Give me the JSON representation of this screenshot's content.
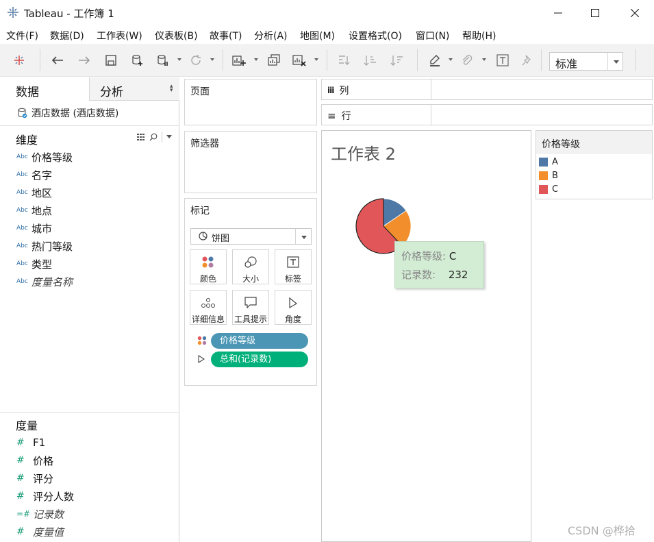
{
  "window": {
    "title": "Tableau - 工作簿 1"
  },
  "menu": [
    "文件(F)",
    "数据(D)",
    "工作表(W)",
    "仪表板(B)",
    "故事(T)",
    "分析(A)",
    "地图(M)",
    "设置格式(O)",
    "窗口(N)",
    "帮助(H)"
  ],
  "toolbar": {
    "view_mode": "标准"
  },
  "data_pane": {
    "tabs": [
      "数据",
      "分析"
    ],
    "datasource": "酒店数据 (酒店数据)",
    "dimensions_title": "维度",
    "dimensions": [
      {
        "type": "Abc",
        "name": "价格等级"
      },
      {
        "type": "Abc",
        "name": "名字"
      },
      {
        "type": "Abc",
        "name": "地区"
      },
      {
        "type": "Abc",
        "name": "地点"
      },
      {
        "type": "Abc",
        "name": "城市"
      },
      {
        "type": "Abc",
        "name": "热门等级"
      },
      {
        "type": "Abc",
        "name": "类型"
      },
      {
        "type": "Abc",
        "name": "度量名称"
      }
    ],
    "measures_title": "度量",
    "measures": [
      {
        "type": "#",
        "name": "F1"
      },
      {
        "type": "#",
        "name": "价格"
      },
      {
        "type": "#",
        "name": "评分"
      },
      {
        "type": "#",
        "name": "评分人数"
      },
      {
        "type": "=#",
        "name": "记录数"
      },
      {
        "type": "#",
        "name": "度量值"
      }
    ]
  },
  "cards": {
    "pages": "页面",
    "filters": "筛选器",
    "marks": "标记",
    "mark_type": "饼图",
    "mark_buttons": [
      "颜色",
      "大小",
      "标签",
      "详细信息",
      "工具提示",
      "角度"
    ],
    "pills": [
      {
        "label": "价格等级",
        "color": "#4a96b4"
      },
      {
        "label": "总和(记录数)",
        "color": "#00b07a"
      }
    ]
  },
  "shelves": {
    "columns_icon": "iii",
    "columns": "列",
    "rows_icon": "≡",
    "rows": "行"
  },
  "view": {
    "sheet_title": "工作表 2"
  },
  "chart_data": {
    "type": "pie",
    "categories": [
      "A",
      "B",
      "C"
    ],
    "values": [
      58,
      84,
      232
    ],
    "colors": [
      "#4e79a7",
      "#f28e2b",
      "#e15759"
    ],
    "selected": "C"
  },
  "tooltip": {
    "field_label": "价格等级:",
    "field_value": "C",
    "measure_label": "记录数:",
    "measure_value": "232"
  },
  "legend": {
    "title": "价格等级",
    "items": [
      {
        "label": "A",
        "color": "#4e79a7"
      },
      {
        "label": "B",
        "color": "#f28e2b"
      },
      {
        "label": "C",
        "color": "#e15759"
      }
    ]
  },
  "watermark": "CSDN @桦拾"
}
